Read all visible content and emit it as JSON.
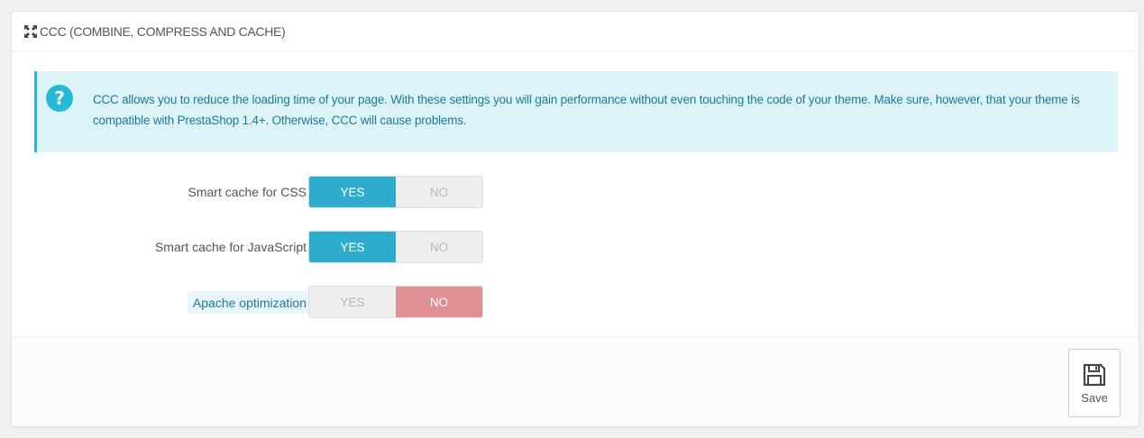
{
  "panel": {
    "title": "CCC (COMBINE, COMPRESS AND CACHE)",
    "icon": "fullscreen-arrows-icon"
  },
  "alert": {
    "icon": "question-circle-icon",
    "text": "CCC allows you to reduce the loading time of your page. With these settings you will gain performance without even touching the code of your theme. Make sure, however, that your theme is compatible with PrestaShop 1.4+. Otherwise, CCC will cause problems."
  },
  "settings": [
    {
      "label": "Smart cache for CSS",
      "yes": "YES",
      "no": "NO",
      "selected": "YES"
    },
    {
      "label": "Smart cache for JavaScript",
      "yes": "YES",
      "no": "NO",
      "selected": "YES"
    },
    {
      "label": "Apache optimization",
      "yes": "YES",
      "no": "NO",
      "selected": "NO"
    }
  ],
  "footer": {
    "save_label": "Save",
    "save_icon": "floppy-disk-icon"
  },
  "colors": {
    "yes_active": "#2eacce",
    "no_active": "#e08f95",
    "alert_bg": "#dcf3f8",
    "alert_border": "#25b9d7"
  }
}
